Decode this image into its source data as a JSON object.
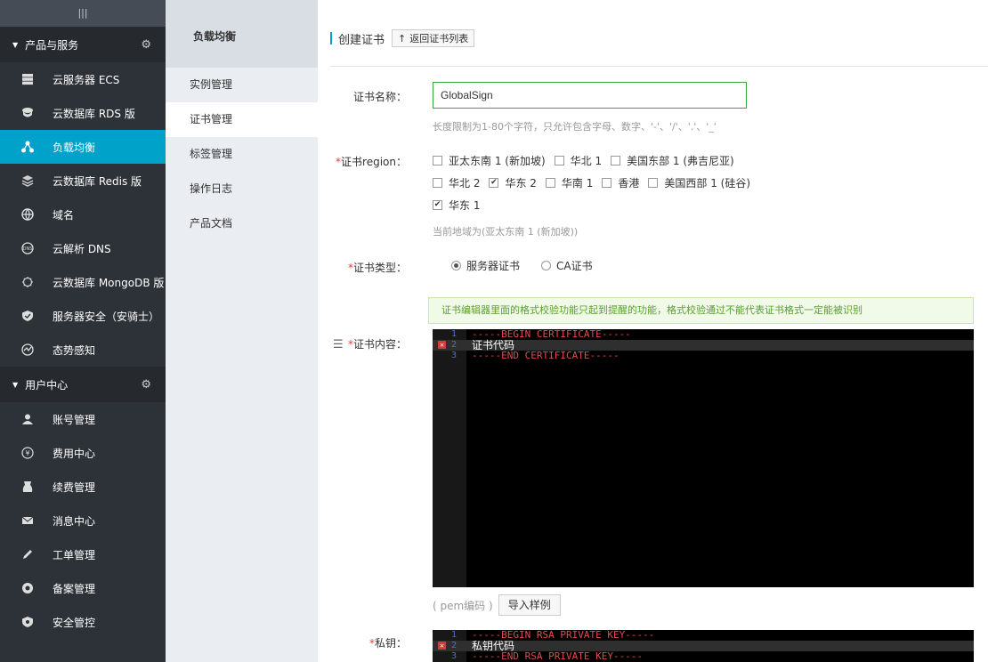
{
  "sidebar": {
    "collapse_glyph": "|||",
    "sections": [
      {
        "label": "产品与服务",
        "items": [
          {
            "label": "云服务器 ECS",
            "icon": "server-icon"
          },
          {
            "label": "云数据库 RDS 版",
            "icon": "database-icon"
          },
          {
            "label": "负载均衡",
            "icon": "load-balancer-icon",
            "active": true
          },
          {
            "label": "云数据库 Redis 版",
            "icon": "redis-icon"
          },
          {
            "label": "域名",
            "icon": "globe-icon"
          },
          {
            "label": "云解析 DNS",
            "icon": "dns-icon"
          },
          {
            "label": "云数据库 MongoDB 版",
            "icon": "mongodb-icon"
          },
          {
            "label": "服务器安全（安骑士）",
            "icon": "shield-icon"
          },
          {
            "label": "态势感知",
            "icon": "awareness-icon"
          }
        ]
      },
      {
        "label": "用户中心",
        "items": [
          {
            "label": "账号管理",
            "icon": "user-icon"
          },
          {
            "label": "费用中心",
            "icon": "yen-icon"
          },
          {
            "label": "续费管理",
            "icon": "renew-icon"
          },
          {
            "label": "消息中心",
            "icon": "mail-icon"
          },
          {
            "label": "工单管理",
            "icon": "pencil-icon"
          },
          {
            "label": "备案管理",
            "icon": "record-icon"
          },
          {
            "label": "安全管控",
            "icon": "security-icon"
          }
        ]
      }
    ]
  },
  "subnav": {
    "title": "负载均衡",
    "items": [
      "实例管理",
      "证书管理",
      "标签管理",
      "操作日志",
      "产品文档"
    ],
    "active_index": 1
  },
  "header": {
    "title": "创建证书",
    "back_label": "返回证书列表"
  },
  "form": {
    "name": {
      "label": "证书名称：",
      "value": "GlobalSign",
      "hint": "长度限制为1-80个字符，只允许包含字母、数字、'-'、'/'、'.'、'_'"
    },
    "region": {
      "label": "证书region：",
      "rows": [
        [
          {
            "label": "亚太东南 1 (新加坡)",
            "checked": false
          },
          {
            "label": "华北 1",
            "checked": false
          },
          {
            "label": "美国东部 1 (弗吉尼亚)",
            "checked": false
          }
        ],
        [
          {
            "label": "华北 2",
            "checked": false
          },
          {
            "label": "华东 2",
            "checked": true
          },
          {
            "label": "华南 1",
            "checked": false
          },
          {
            "label": "香港",
            "checked": false
          },
          {
            "label": "美国西部 1 (硅谷)",
            "checked": false
          }
        ],
        [
          {
            "label": "华东 1",
            "checked": true
          }
        ]
      ],
      "current": "当前地域为(亚太东南 1 (新加坡))"
    },
    "type": {
      "label": "证书类型：",
      "options": [
        {
          "label": "服务器证书",
          "selected": true
        },
        {
          "label": "CA证书",
          "selected": false
        }
      ]
    },
    "notice": "证书编辑器里面的格式校验功能只起到提醒的功能，格式校验通过不能代表证书格式一定能被识别",
    "content": {
      "label": "证书内容：",
      "lines": [
        {
          "num": "1",
          "text": "-----BEGIN CERTIFICATE-----"
        },
        {
          "num": "2",
          "text": "证书代码"
        },
        {
          "num": "3",
          "text": "-----END CERTIFICATE-----"
        }
      ]
    },
    "pem_note": "( pem编码 )",
    "sample_button": "导入样例",
    "private_key": {
      "label": "私钥：",
      "lines": [
        {
          "num": "1",
          "text": "-----BEGIN RSA PRIVATE KEY-----"
        },
        {
          "num": "2",
          "text": "私钥代码"
        },
        {
          "num": "3",
          "text": "-----END RSA PRIVATE KEY-----"
        }
      ]
    },
    "required_mark": "*"
  },
  "colors": {
    "sidebar_bg": "#2d3238",
    "active_bg": "#00a2ca",
    "input_border": "#3aa53a",
    "required": "#e4393c",
    "notice_text": "#5a9e2f"
  }
}
